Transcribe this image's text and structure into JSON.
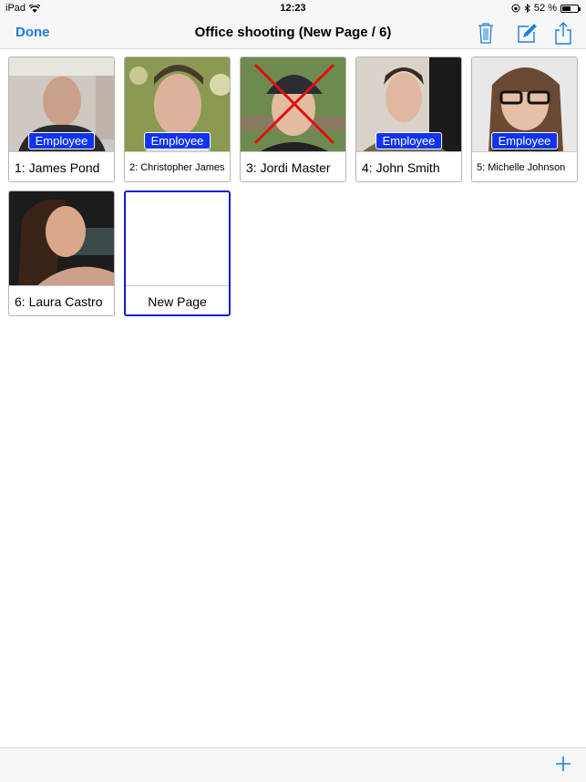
{
  "status_bar": {
    "device": "iPad",
    "time": "12:23",
    "battery": "52 %",
    "battery_level": 0.52
  },
  "navbar": {
    "done_label": "Done",
    "title": "Office shooting (New Page / 6)"
  },
  "pages": [
    {
      "label": "1: James Pond",
      "badge": "Employee",
      "deleted": false
    },
    {
      "label": "2: Christopher James",
      "badge": "Employee",
      "deleted": false
    },
    {
      "label": "3: Jordi Master",
      "badge": null,
      "deleted": true
    },
    {
      "label": "4: John Smith",
      "badge": "Employee",
      "deleted": false
    },
    {
      "label": "5: Michelle Johnson",
      "badge": "Employee",
      "deleted": false
    },
    {
      "label": "6: Laura Castro",
      "badge": null,
      "deleted": false
    },
    {
      "label": "New Page",
      "badge": null,
      "deleted": false,
      "selected": true
    }
  ],
  "colors": {
    "accent": "#1a7fe0",
    "badge": "#1033f0",
    "selected_border": "#1a1ad0",
    "delete_mark": "#e01010"
  }
}
